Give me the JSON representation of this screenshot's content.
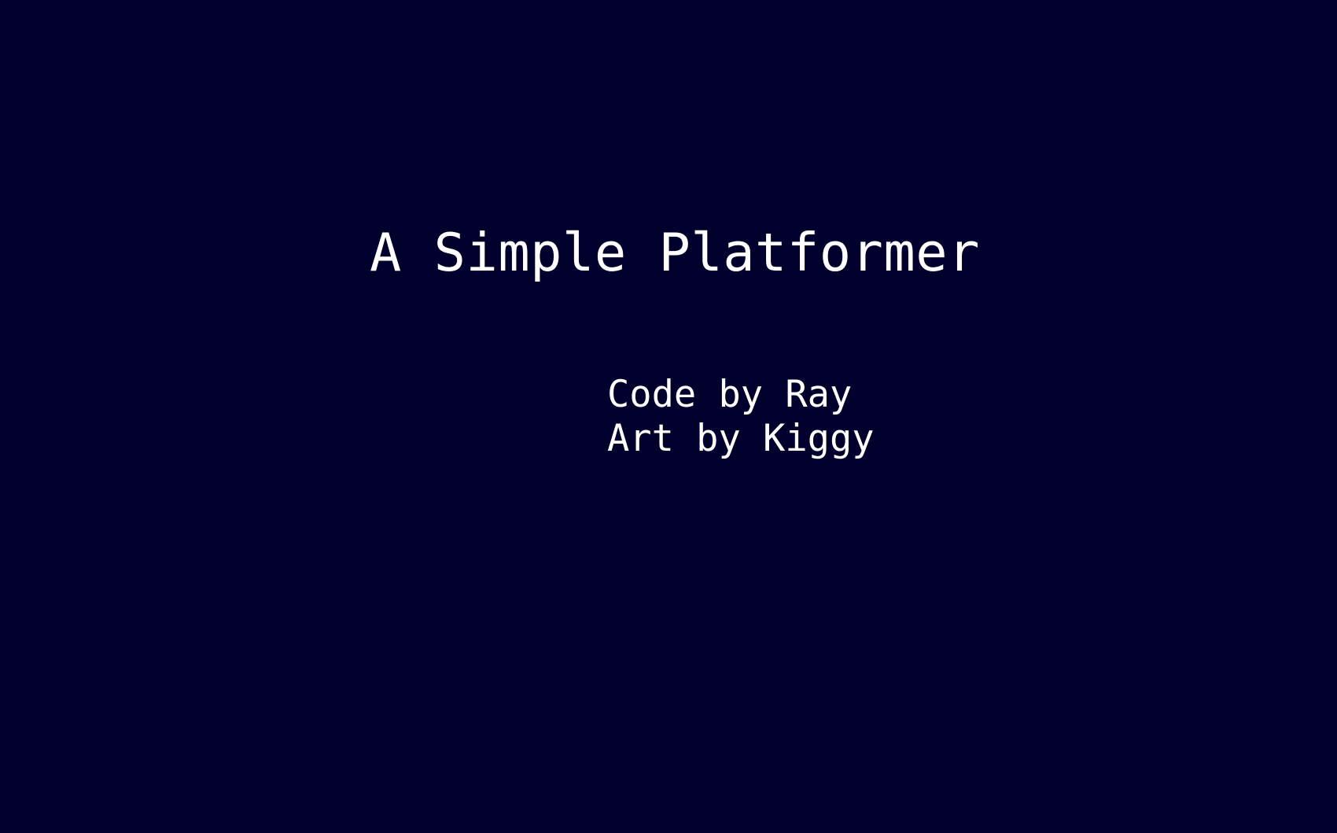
{
  "screen": {
    "background_color": "#01002c",
    "text_color": "#ffffff",
    "title": "A Simple Platformer",
    "credits": [
      "Code by Ray",
      "Art by Kiggy"
    ]
  }
}
